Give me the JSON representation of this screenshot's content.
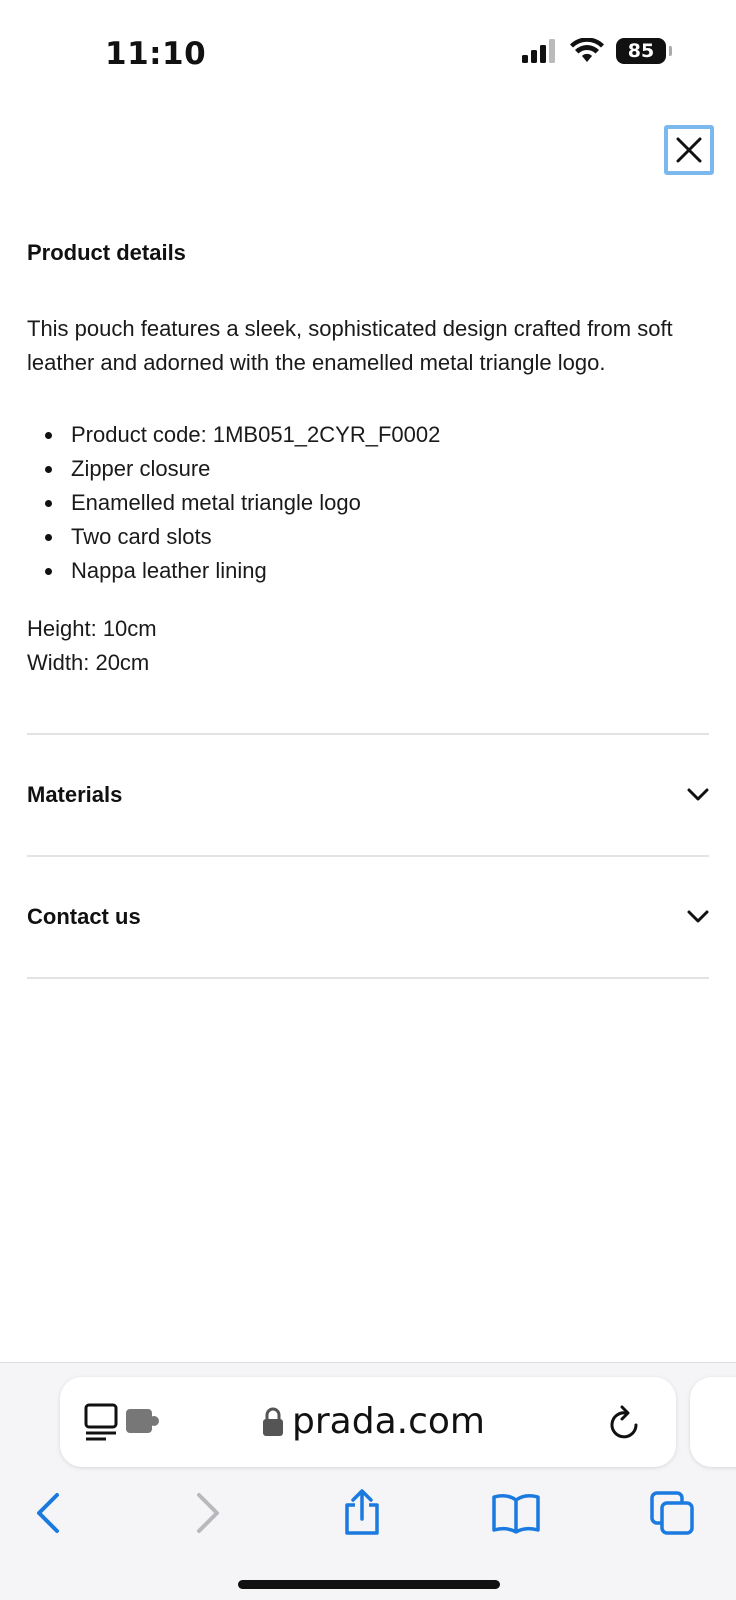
{
  "status_bar": {
    "time": "11:10",
    "battery": "85"
  },
  "panel": {
    "title": "Product details",
    "description": "This pouch features a sleek, sophisticated design crafted from soft leather and adorned with the enamelled metal triangle logo.",
    "features": [
      "Product code: 1MB051_2CYR_F0002",
      "Zipper closure",
      "Enamelled metal triangle logo",
      "Two card slots",
      "Nappa leather lining"
    ],
    "dimensions": [
      "Height: 10cm",
      "Width: 20cm"
    ]
  },
  "accordions": [
    {
      "label": "Materials"
    },
    {
      "label": "Contact us"
    }
  ],
  "browser": {
    "url": "prada.com"
  },
  "colors": {
    "focus_ring": "#7ab8ee",
    "ios_blue": "#1a7ae0",
    "text": "#111111"
  }
}
